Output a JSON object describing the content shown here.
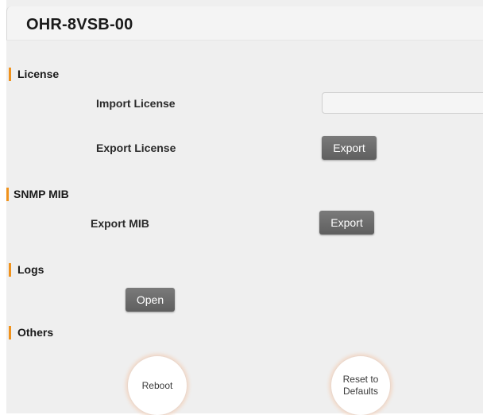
{
  "header": {
    "title": "OHR-8VSB-00"
  },
  "sections": {
    "license": {
      "title": "License",
      "import_label": "Import License",
      "import_value": "",
      "export_label": "Export License",
      "export_button": "Export"
    },
    "snmp": {
      "title": "SNMP MIB",
      "export_label": "Export MIB",
      "export_button": "Export"
    },
    "logs": {
      "title": "Logs",
      "open_button": "Open"
    },
    "others": {
      "title": "Others",
      "reboot_button": "Reboot",
      "reset_line1": "Reset to",
      "reset_line2": "Defaults"
    }
  },
  "colors": {
    "accent": "#f0921c",
    "button": "#6b6b6b",
    "background": "#efefef"
  }
}
